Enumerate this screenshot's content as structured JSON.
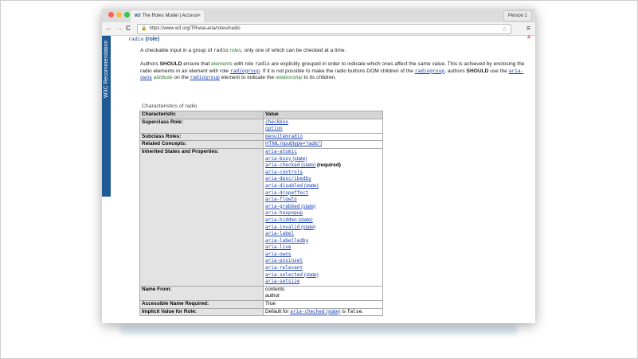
{
  "browser": {
    "tab_title": "The Roles Model | Accessi",
    "tab_icon_text": "W3",
    "tab_close": "×",
    "profile": "Person 1",
    "url": "https://www.w3.org/TR/wai-aria/roles#radio",
    "nav_back": "←",
    "nav_forward": "→",
    "nav_reload": "C",
    "star": "☆",
    "menu": "≡",
    "lock": "🔒"
  },
  "sidebar": {
    "label": "W3C Recommendation"
  },
  "heading": {
    "code": "radio",
    "suffix": " (role)",
    "anchor": "#"
  },
  "intro": {
    "p1a": "A checkable input in a group of ",
    "p1code": "radio",
    "p1term": "roles",
    "p1b": ", only one of which can be checked at a time.",
    "p2a": "Authors ",
    "should": "SHOULD",
    "p2b": " ensure that ",
    "p2term": "elements",
    "p2c": " with role ",
    "p2code": "radio",
    "p2d": " are explicitly grouped in order to indicate which ones affect the same value. This is achieved by enclosing the radio elements in an element with role ",
    "p2code2": "radiogroup",
    "p2e": ". If it is not possible to make the radio buttons DOM children of the ",
    "p2code3": "radiogroup",
    "p2f": ", authors ",
    "p2g": " use the ",
    "p2code4": "aria-owns",
    "p2attr": "attribute",
    "p2h": " on the ",
    "p2code5": "radiogroup",
    "p2i": " element to indicate the ",
    "p2term2": "relationship",
    "p2j": " to its children."
  },
  "table": {
    "caption": "Characteristics of radio",
    "headers": [
      "Characteristic",
      "Value"
    ],
    "superclass_label": "Superclass Role:",
    "superclass": [
      "checkbox",
      "option"
    ],
    "subclass_label": "Subclass Roles:",
    "subclass": "menuitemradio",
    "related_label": "Related Concepts:",
    "related": "HTML input[type=\"radio\"]",
    "inherited_label": "Inherited States and Properties:",
    "inherited": [
      {
        "code": "aria-atomic",
        "suffix": ""
      },
      {
        "code": "aria-busy",
        "suffix": " (state)"
      },
      {
        "code": "aria-checked",
        "suffix": " (state)"
      },
      {
        "code": "aria-controls",
        "suffix": ""
      },
      {
        "code": "aria-describedby",
        "suffix": ""
      },
      {
        "code": "aria-disabled",
        "suffix": " (state)"
      },
      {
        "code": "aria-dropeffect",
        "suffix": ""
      },
      {
        "code": "aria-flowto",
        "suffix": ""
      },
      {
        "code": "aria-grabbed",
        "suffix": " (state)"
      },
      {
        "code": "aria-haspopup",
        "suffix": ""
      },
      {
        "code": "aria-hidden",
        "suffix": " (state)"
      },
      {
        "code": "aria-invalid",
        "suffix": " (state)"
      },
      {
        "code": "aria-label",
        "suffix": ""
      },
      {
        "code": "aria-labelledby",
        "suffix": ""
      },
      {
        "code": "aria-live",
        "suffix": ""
      },
      {
        "code": "aria-owns",
        "suffix": ""
      },
      {
        "code": "aria-posinset",
        "suffix": ""
      },
      {
        "code": "aria-relevant",
        "suffix": ""
      },
      {
        "code": "aria-selected",
        "suffix": " (state)"
      },
      {
        "code": "aria-setsize",
        "suffix": ""
      }
    ],
    "required_note": "(required)",
    "name_from_label": "Name From:",
    "name_from": [
      "contents",
      "author"
    ],
    "accessible_label": "Accessible Name Required:",
    "accessible": "True",
    "implicit_label": "Implicit Value for Role:",
    "implicit_a": "Default for ",
    "implicit_code": "aria-checked",
    "implicit_state": " (state)",
    "implicit_b": " is ",
    "implicit_code2": "false",
    "implicit_end": "."
  },
  "colors": {
    "w3c_blue": "#1f5a94",
    "link": "#1a3fb0",
    "term_green": "#2a7a2a",
    "mac_red": "#fc605c",
    "mac_yellow": "#fdbc40",
    "mac_green": "#34c84a"
  }
}
